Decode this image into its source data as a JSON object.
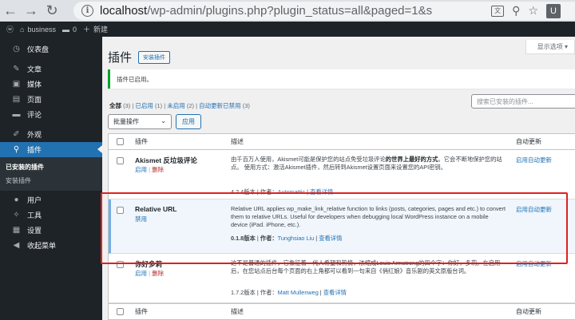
{
  "browser": {
    "url_host": "localhost",
    "url_path": "/wp-admin/plugins.php?plugin_status=all&paged=1&s",
    "profile_initial": "U"
  },
  "adminbar": {
    "site_name": "business",
    "comments_count": "0",
    "new_label": "新建"
  },
  "sidebar": {
    "items": [
      {
        "label": "仪表盘",
        "icon": "dashboard-icon",
        "glyph": "◷"
      },
      {
        "label": "文章",
        "icon": "pin-icon",
        "glyph": "✎"
      },
      {
        "label": "媒体",
        "icon": "media-icon",
        "glyph": "▣"
      },
      {
        "label": "页面",
        "icon": "page-icon",
        "glyph": "▤"
      },
      {
        "label": "评论",
        "icon": "comment-icon",
        "glyph": "▬"
      },
      {
        "label": "外观",
        "icon": "brush-icon",
        "glyph": "✐"
      },
      {
        "label": "插件",
        "icon": "plugin-icon",
        "glyph": "⚲"
      }
    ],
    "submenu": [
      "已安装的插件",
      "安装插件"
    ],
    "items_after": [
      {
        "label": "用户",
        "icon": "users-icon",
        "glyph": "●"
      },
      {
        "label": "工具",
        "icon": "tools-icon",
        "glyph": "✧"
      },
      {
        "label": "设置",
        "icon": "settings-icon",
        "glyph": "▦"
      },
      {
        "label": "收起菜单",
        "icon": "collapse-icon",
        "glyph": "◀"
      }
    ]
  },
  "main": {
    "screen_options": "显示选项 ▾",
    "title": "插件",
    "add_new": "安装插件",
    "notice": "插件已启用。",
    "filters": {
      "all": "全部",
      "all_count": "(3)",
      "active": "已启用",
      "active_count": "(1)",
      "inactive": "未启用",
      "inactive_count": "(2)",
      "auto_disabled": "自动更新已禁用",
      "auto_disabled_count": "(3)"
    },
    "search_placeholder": "搜索已安装的插件...",
    "bulk_action": "批量操作",
    "apply": "应用",
    "columns": {
      "plugin": "插件",
      "description": "描述",
      "auto_update": "自动更新"
    }
  },
  "plugins": [
    {
      "name": "Akismet 反垃圾评论",
      "action1": "启用",
      "action2": "删除",
      "desc_pre": "由千百万人使用，Akismet可能是保护您的站点免受垃圾评论",
      "desc_bold": "的世界上最好的方式",
      "desc_post": "。它会不断地保护您的站点。 使用方式：激活Akismet插件，然后转到Akismet设置页面来设置您的API密钥。",
      "version": "4.2.4版本",
      "author_label": "作者：",
      "author": "Automattic",
      "details": "查看详情",
      "auto": "启用自动更新"
    },
    {
      "name": "Relative URL",
      "action1": "禁用",
      "desc": "Relative URL applies wp_make_link_relative function to links (posts, categories, pages and etc.) to convert them to relative URLs. Useful for developers when debugging local WordPress instance on a mobile device (iPad. iPhone, etc.).",
      "version": "0.1.8版本",
      "author_label": "作者：",
      "author": "Tunghsiao Liu",
      "details": "查看详情",
      "auto": "启用自动更新"
    },
    {
      "name": "你好多莉",
      "action1": "启用",
      "action2": "删除",
      "desc": "这不是普通的插件，它象征着一代人希望和热情，浓缩成Louis Armstrong的四个字：你好，多莉。在启用后，在您站点后台每个页面的右上角都可以看到一句来自《俏红娘》音乐剧的英文原版台词。",
      "version": "1.7.2版本",
      "author_label": "作者：",
      "author": "Matt Mullenweg",
      "details": "查看详情",
      "auto": "启用自动更新"
    }
  ],
  "footer_columns": {
    "plugin": "插件",
    "description": "描述",
    "auto_update": "自动更新"
  }
}
